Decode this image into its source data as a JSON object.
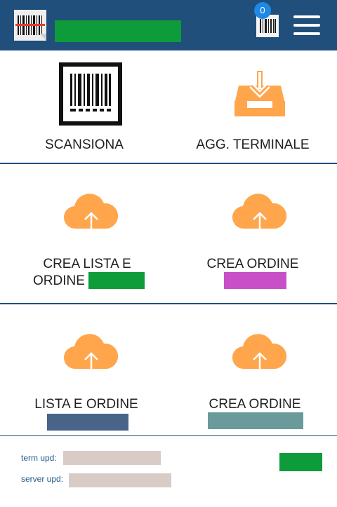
{
  "header": {
    "cart_count": "0",
    "colors": {
      "bar": "#1f4f7a",
      "badge": "#1e88e5",
      "title_redaction": "#0e9c3a"
    }
  },
  "tiles": [
    {
      "label": "SCANSIONA",
      "icon": "barcode-scanner-icon"
    },
    {
      "label": "AGG. TERMINALE",
      "icon": "inbox-download-icon"
    },
    {
      "label_line1": "CREA LISTA E",
      "label_line2": "ORDINE",
      "icon": "cloud-upload-icon"
    },
    {
      "label": "CREA ORDINE",
      "icon": "cloud-upload-icon"
    },
    {
      "label": "LISTA E ORDINE",
      "icon": "cloud-upload-icon"
    },
    {
      "label": "CREA ORDINE",
      "icon": "cloud-upload-icon"
    }
  ],
  "footer": {
    "term_upd_label": "term upd:",
    "server_upd_label": "server upd:"
  },
  "colors": {
    "accent_orange": "#ffa64d",
    "redact_green": "#0e9c3a",
    "redact_magenta": "#c94fc9",
    "redact_slate": "#4a6489",
    "redact_teal": "#6b9a9a",
    "redact_field": "#d9cbc6"
  }
}
